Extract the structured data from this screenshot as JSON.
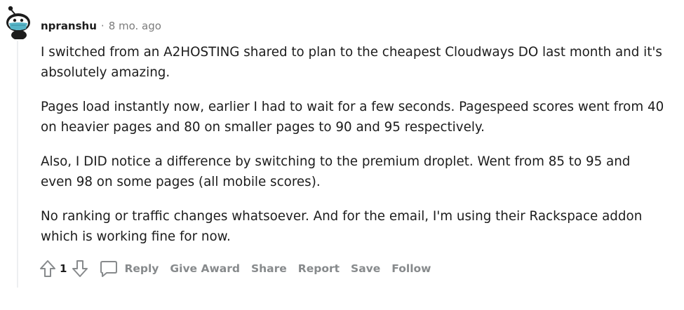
{
  "comment": {
    "username": "npranshu",
    "separator": "·",
    "timestamp": "8 mo. ago",
    "paragraphs": [
      "I switched from an A2HOSTING shared to plan to the cheapest Cloudways DO last month and it's absolutely amazing.",
      "Pages load instantly now, earlier I had to wait for a few seconds. Pagespeed scores went from 40 on heavier pages and 80 on smaller pages to 90 and 95 respectively.",
      "Also, I DID notice a difference by switching to the premium droplet. Went from 85 to 95 and even 98 on some pages (all mobile scores).",
      "No ranking or traffic changes whatsoever. And for the email, I'm using their Rackspace addon which is working fine for now."
    ],
    "score": "1",
    "icons": {
      "avatar": "snoo-avatar-icon",
      "upvote": "upvote-arrow-icon",
      "downvote": "downvote-arrow-icon",
      "reply": "speech-bubble-icon"
    },
    "actions": {
      "reply": "Reply",
      "give_award": "Give Award",
      "share": "Share",
      "report": "Report",
      "save": "Save",
      "follow": "Follow"
    }
  },
  "colors": {
    "text": "#1c1c1c",
    "meta": "#7c7c7c",
    "action": "#878a8c",
    "thread_line": "#edeff1",
    "avatar_mask": "#56b4c7"
  }
}
